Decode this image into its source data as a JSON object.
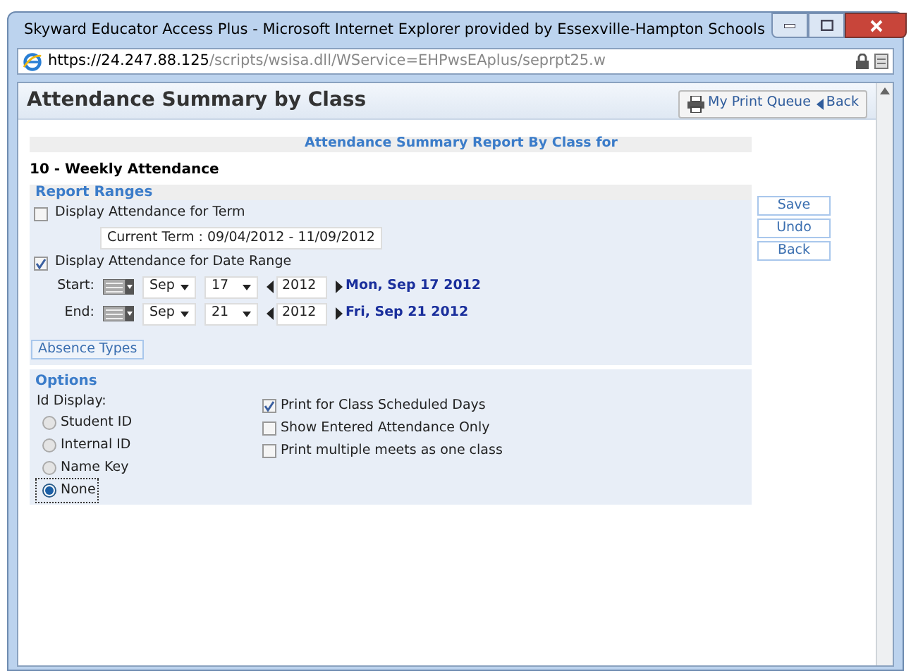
{
  "window": {
    "title": "Skyward Educator Access Plus - Microsoft Internet Explorer provided by Essexville-Hampton Schools"
  },
  "address": {
    "host": "https://24.247.88.125",
    "path": "/scripts/wsisa.dll/WService=EHPwsEAplus/seprpt25.w"
  },
  "page": {
    "title": "Attendance Summary by Class",
    "header_buttons": [
      {
        "kind": "print",
        "label": "My Print Queue"
      },
      {
        "kind": "back",
        "label": "Back"
      }
    ]
  },
  "report": {
    "title": "Attendance Summary Report By Class for",
    "subtitle": "10 -  Weekly Attendance",
    "ranges": {
      "heading": "Report Ranges",
      "term": {
        "label": "Display Attendance for Term",
        "checked": false,
        "select": "Current Term : 09/04/2012 - 11/09/2012"
      },
      "date_range": {
        "label": "Display Attendance for Date Range",
        "checked": true
      },
      "dates": [
        {
          "label": "Start:",
          "month": "Sep",
          "day": "17",
          "year": "2012",
          "display": "Mon, Sep 17 2012"
        },
        {
          "label": "End:",
          "month": "Sep",
          "day": "21",
          "year": "2012",
          "display": "Fri, Sep 21 2012"
        }
      ],
      "absence_button": "Absence Types"
    },
    "side_buttons": [
      "Save",
      "Undo",
      "Back"
    ],
    "options": {
      "heading": "Options",
      "id_label": "Id Display:",
      "id_choices": [
        {
          "label": "Student ID",
          "selected": false
        },
        {
          "label": "Internal ID",
          "selected": false
        },
        {
          "label": "Name Key",
          "selected": false
        },
        {
          "label": "None",
          "selected": true
        }
      ],
      "checkboxes": [
        {
          "label": "Print for Class Scheduled Days",
          "checked": true
        },
        {
          "label": "Show Entered Attendance Only",
          "checked": false
        },
        {
          "label": "Print multiple meets as one class",
          "checked": false
        }
      ]
    }
  }
}
